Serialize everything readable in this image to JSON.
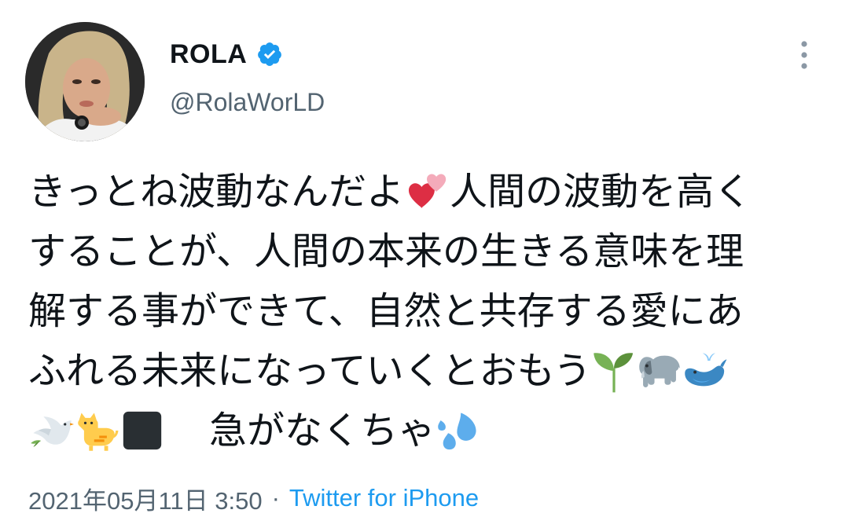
{
  "author": {
    "display_name": "ROLA",
    "handle": "@RolaWorLD",
    "verified": true
  },
  "tweet": {
    "lines": [
      [
        "きっとね波動なんだよ",
        {
          "emoji": "two-hearts"
        },
        "人間の波動を高く"
      ],
      [
        "することが、人間の本来の生きる意味を理"
      ],
      [
        "解する事ができて、自然と共存する愛にあ"
      ],
      [
        "ふれる未来になっていくとおもう",
        {
          "emoji": "seedling"
        },
        {
          "emoji": "elephant"
        },
        {
          "emoji": "spouting-whale"
        }
      ],
      [
        {
          "emoji": "dove"
        },
        {
          "emoji": "cat"
        },
        {
          "emoji": "black-square"
        },
        "gap",
        "急がなくちゃ",
        {
          "emoji": "sweat-droplets"
        }
      ]
    ]
  },
  "meta": {
    "timestamp": "2021年05月11日 3:50",
    "separator": "·",
    "source": "Twitter for iPhone"
  },
  "colors": {
    "text_primary": "#0f1419",
    "text_secondary": "#536471",
    "link": "#1d9bf0",
    "verified": "#1d9bf0"
  }
}
